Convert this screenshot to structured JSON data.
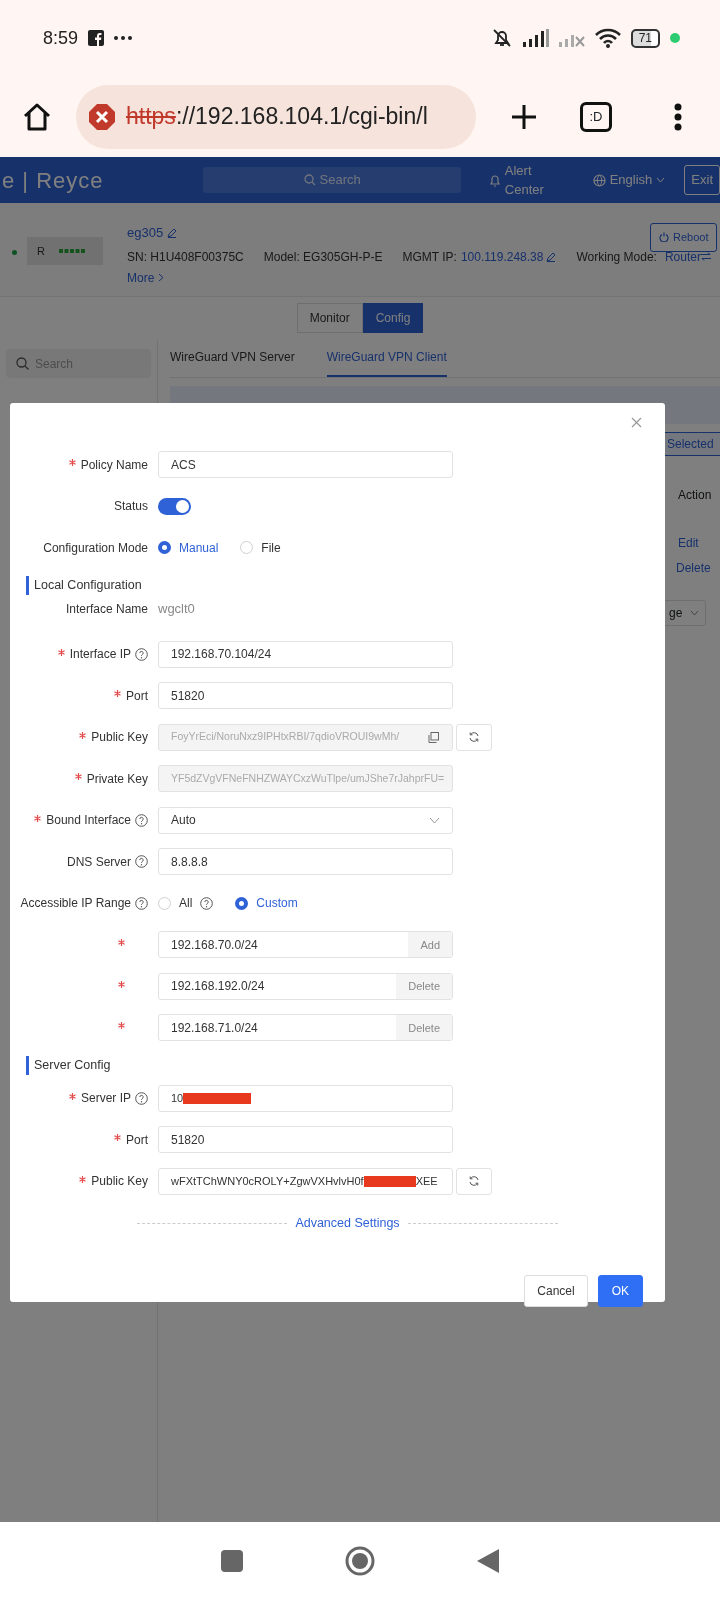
{
  "status_bar": {
    "time": "8:59",
    "battery": "71"
  },
  "browser": {
    "url_scheme": "https",
    "url_rest": "://192.168.104.1/cgi-bin/l",
    "tab_switcher": ":D"
  },
  "header": {
    "logo": "e | Reyce",
    "search_placeholder": "Search",
    "alert_center": "Alert Center",
    "language": "English",
    "exit": "Exit"
  },
  "device": {
    "name": "eg305",
    "sn": "SN: H1U408F00375C",
    "model": "Model: EG305GH-P-E",
    "mgmt_label": "MGMT IP:",
    "mgmt_ip": "100.119.248.38",
    "mode_label": "Working Mode:",
    "mode": "Router",
    "more": "More",
    "reboot": "Reboot",
    "device_label": "R"
  },
  "mode_tabs": [
    {
      "label": "Monitor",
      "selected": false
    },
    {
      "label": "Config",
      "selected": true
    }
  ],
  "sidebar": {
    "search_placeholder": "Search"
  },
  "vpn_tabs": [
    {
      "label": "WireGuard VPN Server",
      "selected": false
    },
    {
      "label": "WireGuard VPN Client",
      "selected": true
    }
  ],
  "backdrop": {
    "selected_button": "Selected",
    "action_header": "Action",
    "edit": "Edit",
    "delete": "Delete",
    "page_select": "ge"
  },
  "modal": {
    "fields": [
      {
        "kind": "input",
        "label": "Policy Name",
        "required": true,
        "value": "ACS"
      },
      {
        "kind": "switch",
        "label": "Status",
        "on": true
      },
      {
        "kind": "radio",
        "label": "Configuration Mode",
        "options": [
          {
            "label": "Manual",
            "selected": true
          },
          {
            "label": "File",
            "selected": false
          }
        ]
      },
      {
        "kind": "section",
        "title": "Local Configuration"
      },
      {
        "kind": "static",
        "label": "Interface Name",
        "value": "wgclt0"
      },
      {
        "kind": "input",
        "label": "Interface IP",
        "required": true,
        "help": true,
        "value": "192.168.70.104/24"
      },
      {
        "kind": "input",
        "label": "Port",
        "required": true,
        "value": "51820"
      },
      {
        "kind": "input",
        "label": "Public Key",
        "required": true,
        "disabled": true,
        "copy": true,
        "refresh": true,
        "value": "FoyYrEci/NoruNxz9IPHtxRBI/7qdioVROUI9wMh/"
      },
      {
        "kind": "input",
        "label": "Private Key",
        "required": true,
        "disabled": true,
        "value": "YF5dZVgVFNeFNHZWAYCxzWuTlpe/umJShe7rJahprFU="
      },
      {
        "kind": "select",
        "label": "Bound Interface",
        "required": true,
        "help": true,
        "value": "Auto"
      },
      {
        "kind": "input",
        "label": "DNS Server",
        "help": true,
        "value": "8.8.8.8"
      },
      {
        "kind": "radio",
        "label": "Accessible IP Range",
        "help": true,
        "options": [
          {
            "label": "All",
            "selected": false,
            "help": true
          },
          {
            "label": "Custom",
            "selected": true
          }
        ]
      },
      {
        "kind": "ip",
        "required": true,
        "value": "192.168.70.0/24",
        "action": "Add"
      },
      {
        "kind": "ip",
        "required": true,
        "value": "192.168.192.0/24",
        "action": "Delete"
      },
      {
        "kind": "ip",
        "required": true,
        "value": "192.168.71.0/24",
        "action": "Delete"
      },
      {
        "kind": "section",
        "title": "Server Config"
      },
      {
        "kind": "input",
        "label": "Server IP",
        "required": true,
        "help": true,
        "value": "10",
        "redacted": true
      },
      {
        "kind": "input",
        "label": "Port",
        "required": true,
        "value": "51820"
      },
      {
        "kind": "input",
        "label": "Public Key",
        "required": true,
        "refresh": true,
        "value": "wFXtTChWNY0cROLY+ZgwVXHvlvH0f",
        "redacted": true,
        "value_end": "XEE"
      }
    ],
    "advanced": "Advanced Settings",
    "buttons": [
      {
        "label": "Cancel",
        "kind": "secondary"
      },
      {
        "label": "OK",
        "kind": "primary"
      }
    ]
  }
}
